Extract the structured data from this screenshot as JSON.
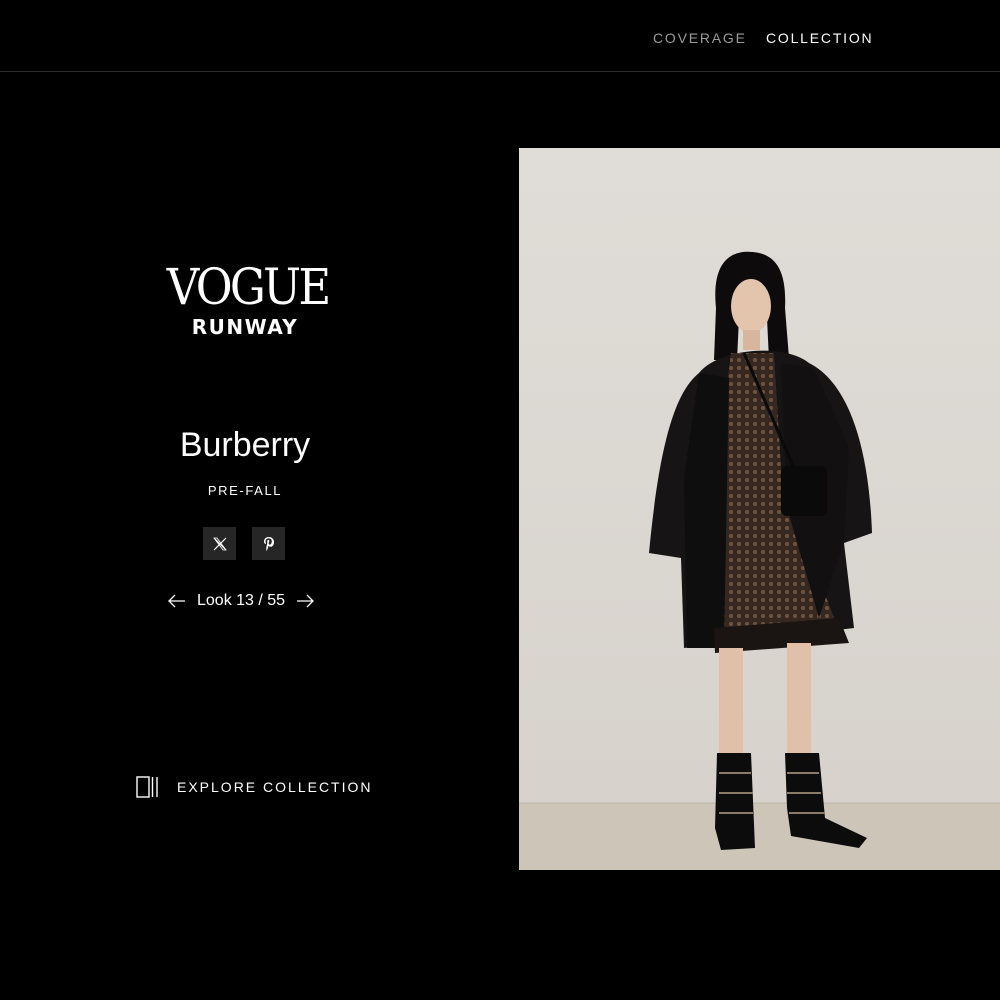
{
  "nav": {
    "coverage": "COVERAGE",
    "collection": "COLLECTION"
  },
  "logo": {
    "line1": "VOGUE",
    "line2": "RUNWAY"
  },
  "show": {
    "designer": "Burberry",
    "season": "PRE-FALL"
  },
  "share": [
    {
      "icon": "x-icon"
    },
    {
      "icon": "pinterest-icon"
    }
  ],
  "look": {
    "text": "Look 13 / 55",
    "prev_icon": "arrow-left-icon",
    "next_icon": "arrow-right-icon"
  },
  "explore": {
    "label": "EXPLORE COLLECTION",
    "icon": "collection-grid-icon"
  },
  "colors": {
    "background": "#000000",
    "nav_inactive": "#9a9a9a",
    "nav_active": "#ffffff",
    "share_bg": "#262626"
  }
}
